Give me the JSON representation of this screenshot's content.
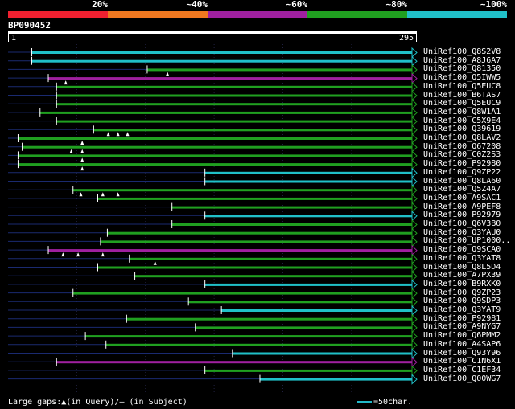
{
  "legend": {
    "colors": [
      "#ef2030",
      "#f07820",
      "#a020a0",
      "#20a020",
      "#20c0c8"
    ],
    "labels": [
      "20%",
      "~40%",
      "~60%",
      "~80%",
      "~100%"
    ]
  },
  "query": {
    "id": "BP090452",
    "start": "1",
    "end": "295",
    "length": 295
  },
  "hits": [
    {
      "name": "UniRef100_Q8S2V8",
      "start": 18,
      "color": "#20c0c8",
      "gaps": []
    },
    {
      "name": "UniRef100_A8J6A7",
      "start": 18,
      "color": "#20c0c8",
      "gaps": []
    },
    {
      "name": "UniRef100_Q81350",
      "start": 102,
      "color": "#20a020",
      "gaps": [
        117
      ]
    },
    {
      "name": "UniRef100_Q5IWW5",
      "start": 30,
      "color": "#a020a0",
      "gaps": [
        43
      ]
    },
    {
      "name": "UniRef100_Q5EUC8",
      "start": 36,
      "color": "#20a020",
      "gaps": []
    },
    {
      "name": "UniRef100_B6TAS7",
      "start": 36,
      "color": "#20a020",
      "gaps": []
    },
    {
      "name": "UniRef100_Q5EUC9",
      "start": 36,
      "color": "#20a020",
      "gaps": []
    },
    {
      "name": "UniRef100_Q8W1A1",
      "start": 24,
      "color": "#20a020",
      "gaps": []
    },
    {
      "name": "UniRef100_C5X9E4",
      "start": 36,
      "color": "#20a020",
      "gaps": []
    },
    {
      "name": "UniRef100_Q39619",
      "start": 63,
      "color": "#20a020",
      "gaps": [
        74,
        81,
        88
      ]
    },
    {
      "name": "UniRef100_Q8LAV2",
      "start": 8,
      "color": "#20a020",
      "gaps": [
        55
      ]
    },
    {
      "name": "UniRef100_Q67208",
      "start": 11,
      "color": "#20a020",
      "gaps": [
        47,
        55
      ]
    },
    {
      "name": "UniRef100_C0Z2S3",
      "start": 8,
      "color": "#20a020",
      "gaps": [
        55
      ]
    },
    {
      "name": "UniRef100_P92980",
      "start": 8,
      "color": "#20a020",
      "gaps": [
        55
      ]
    },
    {
      "name": "UniRef100_Q9ZP22",
      "start": 144,
      "color": "#20c0c8",
      "gaps": []
    },
    {
      "name": "UniRef100_Q8LA60",
      "start": 144,
      "color": "#20c0c8",
      "gaps": []
    },
    {
      "name": "UniRef100_Q5Z4A7",
      "start": 48,
      "color": "#20a020",
      "gaps": [
        54,
        70,
        81
      ]
    },
    {
      "name": "UniRef100_A9SAC1",
      "start": 66,
      "color": "#20a020",
      "gaps": []
    },
    {
      "name": "UniRef100_A9PEF8",
      "start": 120,
      "color": "#20a020",
      "gaps": []
    },
    {
      "name": "UniRef100_P92979",
      "start": 144,
      "color": "#20c0c8",
      "gaps": []
    },
    {
      "name": "UniRef100_Q6V3B0",
      "start": 120,
      "color": "#20a020",
      "gaps": []
    },
    {
      "name": "UniRef100_Q3YAU0",
      "start": 73,
      "color": "#20a020",
      "gaps": []
    },
    {
      "name": "UniRef100_UP1000..",
      "start": 68,
      "color": "#20a020",
      "gaps": []
    },
    {
      "name": "UniRef100_Q9SCA0",
      "start": 30,
      "color": "#a020a0",
      "gaps": [
        41,
        52,
        70
      ]
    },
    {
      "name": "UniRef100_Q3YAT8",
      "start": 89,
      "color": "#20a020",
      "gaps": [
        108
      ]
    },
    {
      "name": "UniRef100_Q8L5D4",
      "start": 66,
      "color": "#20a020",
      "gaps": []
    },
    {
      "name": "UniRef100_A7PX39",
      "start": 93,
      "color": "#20a020",
      "gaps": []
    },
    {
      "name": "UniRef100_B9RXK0",
      "start": 144,
      "color": "#20c0c8",
      "gaps": []
    },
    {
      "name": "UniRef100_Q9ZP23",
      "start": 48,
      "color": "#20a020",
      "gaps": []
    },
    {
      "name": "UniRef100_Q9SDP3",
      "start": 132,
      "color": "#20a020",
      "gaps": []
    },
    {
      "name": "UniRef100_Q3YAT9",
      "start": 156,
      "color": "#20c0c8",
      "gaps": []
    },
    {
      "name": "UniRef100_P92981",
      "start": 87,
      "color": "#20a020",
      "gaps": []
    },
    {
      "name": "UniRef100_A9NYG7",
      "start": 137,
      "color": "#20a020",
      "gaps": []
    },
    {
      "name": "UniRef100_Q6PMM2",
      "start": 57,
      "color": "#20a020",
      "gaps": []
    },
    {
      "name": "UniRef100_A4SAP6",
      "start": 72,
      "color": "#20a020",
      "gaps": []
    },
    {
      "name": "UniRef100_Q93Y96",
      "start": 164,
      "color": "#20c0c8",
      "gaps": []
    },
    {
      "name": "UniRef100_C1N6X1",
      "start": 36,
      "color": "#a020a0",
      "gaps": []
    },
    {
      "name": "UniRef100_C1EF34",
      "start": 144,
      "color": "#20a020",
      "gaps": []
    },
    {
      "name": "UniRef100_Q00WG7",
      "start": 184,
      "color": "#20c0c8",
      "gaps": []
    }
  ],
  "footer": {
    "gaps_text": "Large gaps:▲(in Query)/– (in Subject)",
    "scale_text": "=50char."
  }
}
